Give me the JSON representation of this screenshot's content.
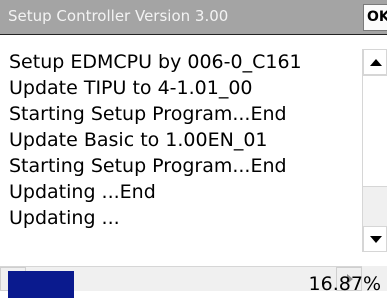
{
  "titlebar": {
    "title": "Setup Controller   Version 3.00",
    "ok_label": "OK"
  },
  "log": {
    "lines": [
      "Setup EDMCPU by 006-0_C161",
      "Update TIPU to 4-1.01_00",
      "Starting Setup Program...End",
      "Update Basic to 1.00EN_01",
      "Starting Setup Program...End",
      "Updating ...End",
      "Updating ..."
    ]
  },
  "progress": {
    "fraction": 0.1687,
    "label": "16.87%"
  },
  "icons": {
    "scroll_up": "triangle-up-icon",
    "scroll_down": "triangle-down-icon",
    "scroll_left": "triangle-left-icon",
    "scroll_right": "triangle-right-icon"
  },
  "colors": {
    "titlebar": "#a4a4a4",
    "progress_fill": "#0a1a8e"
  }
}
